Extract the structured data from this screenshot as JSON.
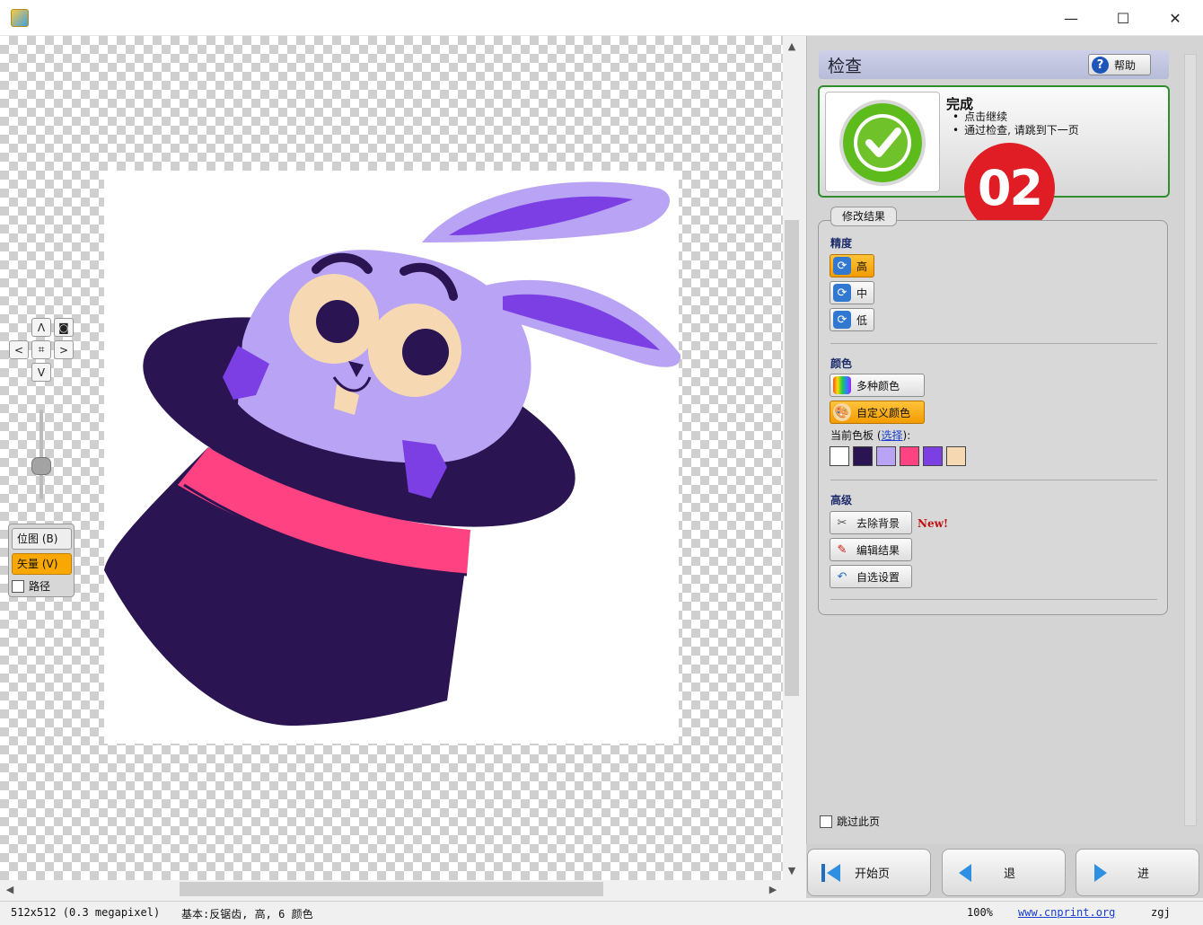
{
  "window": {
    "minimize": "—",
    "maximize": "☐",
    "close": "✕"
  },
  "nav_controls": {
    "up": "Λ",
    "down": "V",
    "left": "<",
    "right": ">",
    "fit": "⌗",
    "center": "◙"
  },
  "view_mode": {
    "bitmap": "位图 (B)",
    "vector": "矢量 (V)",
    "paths": "路径"
  },
  "panel": {
    "title": "检查",
    "help_label": "帮助",
    "status_title": "完成",
    "status_items": [
      "点击继续",
      "通过检查, 请跳到下一页"
    ],
    "badge": "02",
    "group_title": "修改结果",
    "precision_label": "精度",
    "precision_high": "高",
    "precision_mid": "中",
    "precision_low": "低",
    "color_label": "颜色",
    "multi_color": "多种颜色",
    "custom_color": "自定义颜色",
    "palette_prefix": "当前色板 (",
    "palette_link": "选择",
    "palette_suffix": "):",
    "palette": [
      "#ffffff",
      "#2a1452",
      "#b8a3f5",
      "#ff4382",
      "#7b3fe4",
      "#f6d9b2"
    ],
    "advanced_label": "高级",
    "remove_bg": "去除背景",
    "new_tag": "New!",
    "edit_result": "编辑结果",
    "options": "自选设置",
    "skip_page": "跳过此页"
  },
  "bottom_nav": {
    "start": "开始页",
    "back": "退",
    "forward": "进"
  },
  "statusbar": {
    "size": "512x512 (0.3 megapixel)",
    "info": "基本:反锯齿, 高, 6 颜色",
    "zoom": "100%",
    "link": "www.cnprint.org",
    "user": "zgj"
  }
}
